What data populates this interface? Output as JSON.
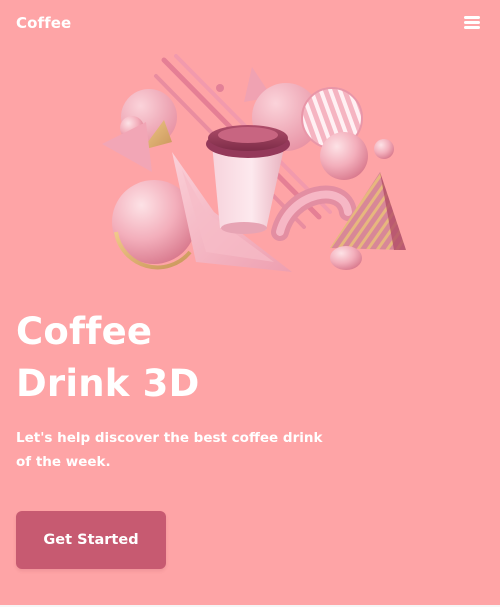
{
  "header": {
    "brand": "Coffee",
    "menu_icon": "hamburger-menu-icon"
  },
  "hero": {
    "illustration_icon": "3d-coffee-cup-illustration",
    "title_line1": "Coffee",
    "title_line2": "Drink 3D",
    "subtitle": "Let's help discover the best coffee drink of the week.",
    "cta_label": "Get Started"
  },
  "colors": {
    "background": "#fea4a6",
    "button": "#c75a71",
    "text": "#ffffff"
  }
}
